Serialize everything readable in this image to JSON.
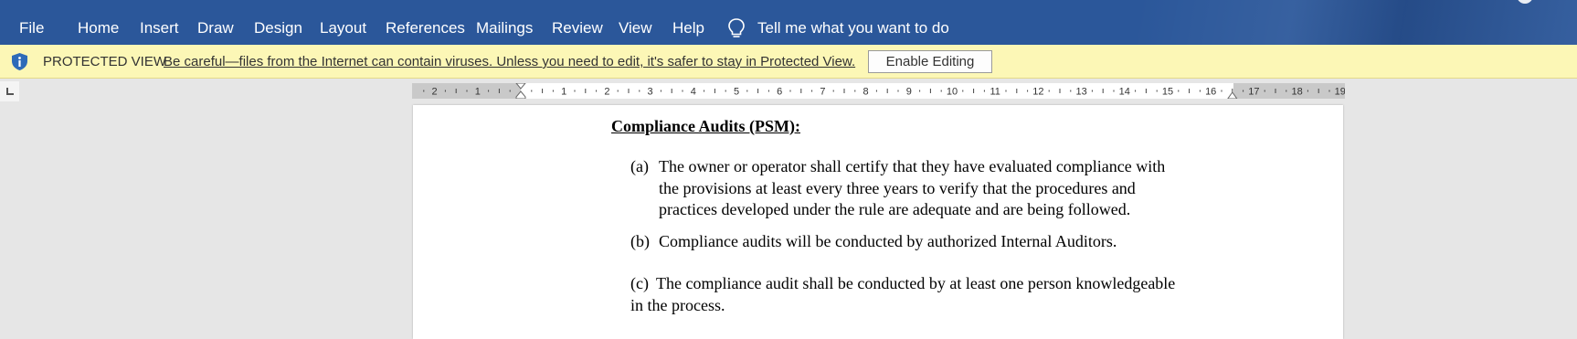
{
  "ribbon": {
    "tabs": [
      "File",
      "Home",
      "Insert",
      "Draw",
      "Design",
      "Layout",
      "References",
      "Mailings",
      "Review",
      "View",
      "Help"
    ],
    "tell_me": "Tell me what you want to do",
    "colors": {
      "ribbon_bg": "#2b579a",
      "protected_bar_bg": "#fcf7b6"
    }
  },
  "protected_view": {
    "label": "PROTECTED VIEW",
    "message": "Be careful—files from the Internet can contain viruses. Unless you need to edit, it's safer to stay in Protected View.",
    "button": "Enable Editing",
    "icon": "info-shield-icon"
  },
  "ruler": {
    "left_numbers": [
      "2",
      "1"
    ],
    "right_numbers": [
      "1",
      "2",
      "3",
      "4",
      "5",
      "6",
      "7",
      "8",
      "9",
      "10",
      "11",
      "12",
      "13",
      "14",
      "15",
      "16",
      "17",
      "18",
      "19"
    ]
  },
  "document": {
    "heading": "Compliance Audits (PSM):",
    "items": [
      {
        "label": "(a)",
        "lines": [
          "The owner or operator shall certify that they have evaluated compliance with",
          "the provisions at least every three years to verify that the procedures and",
          "practices developed under the rule are adequate and are being followed."
        ]
      },
      {
        "label": "(b)",
        "lines": [
          "Compliance audits will be conducted by authorized Internal Auditors."
        ]
      },
      {
        "label": "(c)",
        "lines": [
          "The compliance audit shall be conducted by at least one person knowledgeable",
          "in the process."
        ]
      }
    ]
  }
}
